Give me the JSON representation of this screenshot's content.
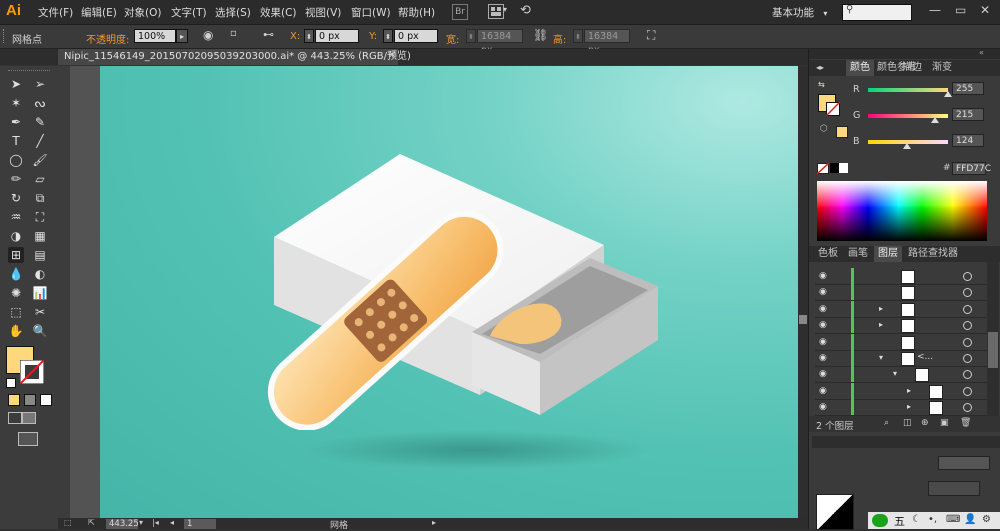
{
  "app": {
    "logo": "Ai"
  },
  "menu": [
    "文件(F)",
    "编辑(E)",
    "对象(O)",
    "文字(T)",
    "选择(S)",
    "效果(C)",
    "视图(V)",
    "窗口(W)",
    "帮助(H)"
  ],
  "workspace": {
    "label": "基本功能",
    "chevron": "▾"
  },
  "window_controls": {
    "minimize": "—",
    "restore": "▭",
    "close": "✕"
  },
  "control_bar": {
    "selection_label": "网格点",
    "opacity_label": "不透明度:",
    "opacity_value": "100%",
    "x_label": "X:",
    "x_value": "0 px",
    "y_label": "Y:",
    "y_value": "0 px",
    "width_label": "宽:",
    "width_value": "16384 px",
    "height_label": "高:",
    "height_value": "16384 px"
  },
  "document": {
    "tab_title": "Nipic_11546149_20150702095039203000.ai* @ 443.25% (RGB/预览)",
    "close": "✕"
  },
  "status": {
    "zoom": "443.25",
    "page": "1",
    "mode": "网格"
  },
  "color_panel": {
    "tabs": [
      "颜色",
      "颜色参考",
      "描边",
      "渐变"
    ],
    "active_tab": 0,
    "channels": [
      {
        "name": "R",
        "value": "255",
        "level": 1.0
      },
      {
        "name": "G",
        "value": "215",
        "level": 0.843
      },
      {
        "name": "B",
        "value": "124",
        "level": 0.486
      }
    ],
    "hex_symbol": "#",
    "hex": "FFD77C",
    "fill_color": "#ffd77c"
  },
  "layers_panel": {
    "tabs": [
      "色板",
      "画笔",
      "图层",
      "路径查找器"
    ],
    "active_tab": 2,
    "rows": [
      {
        "indent": 0,
        "expander": "",
        "label": ""
      },
      {
        "indent": 0,
        "expander": "",
        "label": ""
      },
      {
        "indent": 0,
        "expander": "▸",
        "label": ""
      },
      {
        "indent": 0,
        "expander": "▸",
        "label": ""
      },
      {
        "indent": 0,
        "expander": "",
        "label": ""
      },
      {
        "indent": 0,
        "expander": "▾",
        "label": "<..."
      },
      {
        "indent": 1,
        "expander": "▾",
        "label": ""
      },
      {
        "indent": 2,
        "expander": "▸",
        "label": ""
      },
      {
        "indent": 2,
        "expander": "▸",
        "label": ""
      }
    ],
    "count_label": "2 个图层"
  },
  "accent": {
    "layer_bar": "#4ec94e",
    "artboard_teal": "#52c2b4",
    "ai_orange": "#ff9a00"
  }
}
